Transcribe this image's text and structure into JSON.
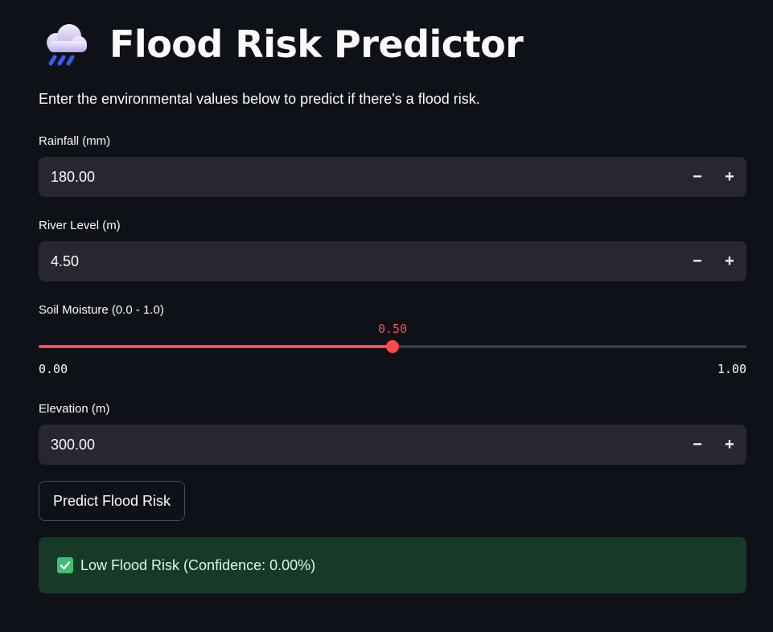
{
  "app": {
    "title": "Flood Risk Predictor",
    "title_icon": "cloud-with-rain-icon",
    "subtitle": "Enter the environmental values below to predict if there's a flood risk."
  },
  "fields": {
    "rainfall": {
      "label": "Rainfall (mm)",
      "value": "180.00"
    },
    "river_level": {
      "label": "River Level (m)",
      "value": "4.50"
    },
    "soil_moisture": {
      "label": "Soil Moisture (0.0 - 1.0)",
      "value": "0.50",
      "min": "0.00",
      "max": "1.00",
      "fraction": 0.5
    },
    "elevation": {
      "label": "Elevation (m)",
      "value": "300.00"
    }
  },
  "stepper": {
    "minus": "−",
    "plus": "+"
  },
  "predict_button": {
    "label": "Predict Flood Risk"
  },
  "result": {
    "text": "Low Flood Risk (Confidence: 0.00%)",
    "icon": "check-mark-icon"
  },
  "colors": {
    "background": "#0e1117",
    "input_bg": "#262730",
    "accent": "#ff4b4b",
    "success_bg": "#173928",
    "success_icon": "#3fbf6f"
  }
}
